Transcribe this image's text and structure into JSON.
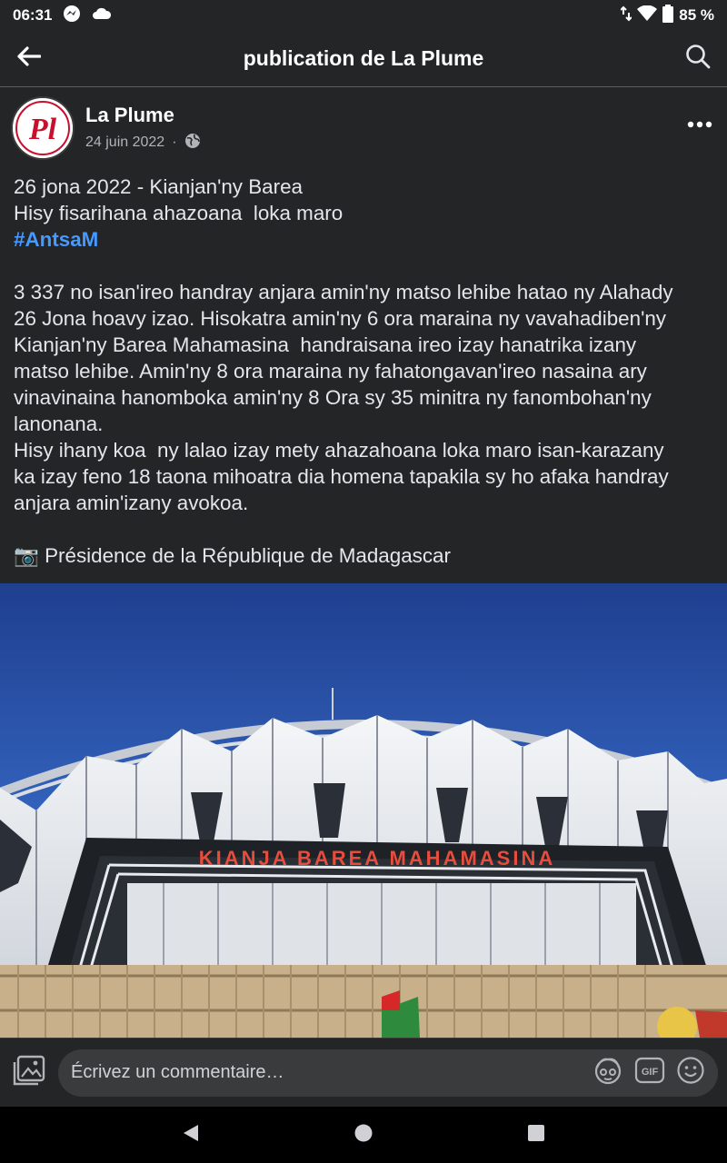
{
  "status_bar": {
    "time": "06:31",
    "battery": "85 %"
  },
  "header": {
    "title": "publication de La Plume"
  },
  "post": {
    "avatar_text": "Pl",
    "author": "La Plume",
    "date": "24 juin 2022",
    "dot": "·",
    "lines": [
      "26 jona 2022 - Kianjan'ny Barea",
      "Hisy fisarihana ahazoana  loka maro",
      "",
      "",
      "3 337 no isan'ireo handray anjara amin'ny matso lehibe hatao ny Alahady",
      "26 Jona hoavy izao. Hisokatra amin'ny 6 ora maraina ny vavahadiben'ny",
      "Kianjan'ny Barea Mahamasina  handraisana ireo izay hanatrika izany",
      "matso lehibe. Amin'ny 8 ora maraina ny fahatongavan'ireo nasaina ary",
      "vinavinaina hanomboka amin'ny 8 Ora sy 35 minitra ny fanombohan'ny",
      "lanonana.",
      "Hisy ihany koa  ny lalao izay mety ahazahoana loka maro isan-karazany",
      "ka izay feno 18 taona mihoatra dia homena tapakila sy ho afaka handray",
      "anjara amin'izany avokoa.",
      "",
      "📷 Présidence de la République de Madagascar"
    ],
    "hashtag": "#AntsaM",
    "photo_sign": "KIANJA BAREA MAHAMASINA"
  },
  "comment": {
    "placeholder": "Écrivez un commentaire…",
    "gif_label": "GIF"
  },
  "icons": {
    "back": "arrow-left-icon",
    "search": "search-icon",
    "more": "more-options-icon",
    "globe": "globe-icon",
    "photo": "photo-icon",
    "avatar_sticker": "avatar-sticker-icon",
    "gif": "gif-icon",
    "emoji": "emoji-icon"
  }
}
